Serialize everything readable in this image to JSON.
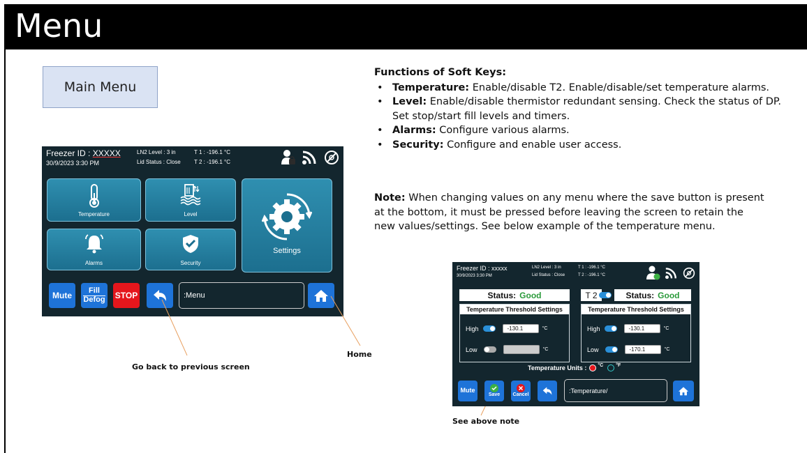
{
  "slide": {
    "title": "Menu",
    "main_menu_label": "Main Menu"
  },
  "device": {
    "freezer_id_label": "Freezer ID :",
    "freezer_id_value": "XXXXX",
    "datetime": "30/9/2023   3:30 PM",
    "ln2_level": "LN2 Level : 3 in",
    "lid_status": "Lid Status : Close",
    "t1": "T 1 : -196.1 °C",
    "t2": "T 2 : -196.1 °C",
    "tiles": {
      "temperature": "Temperature",
      "level": "Level",
      "alarms": "Alarms",
      "security": "Security",
      "settings": "Settings"
    },
    "buttons": {
      "mute": "Mute",
      "fill": "Fill",
      "defog": "Defog",
      "stop": "STOP"
    },
    "breadcrumb": ":Menu"
  },
  "annotations": {
    "back": "Go back to previous screen",
    "home": "Home",
    "save_note": "See above note"
  },
  "functions": {
    "heading": "Functions of Soft Keys:",
    "items": [
      {
        "term": "Temperature:",
        "text": " Enable/disable T2.  Enable/disable/set temperature alarms."
      },
      {
        "term": "Level:",
        "text": "  Enable/disable thermistor redundant sensing.  Check the status of DP.  Set stop/start fill levels and timers."
      },
      {
        "term": "Alarms:",
        "text": " Configure various alarms."
      },
      {
        "term": "Security:",
        "text": " Configure and enable user access."
      }
    ]
  },
  "note": {
    "label": "Note:",
    "text": "  When changing values on any menu where the save button is present at the bottom, it must be pressed before leaving the screen to retain the new values/settings.  See below example of the temperature menu."
  },
  "temp_screen": {
    "freezer_id": "Freezer ID : xxxxx",
    "datetime": "30/9/2023    3:30 PM",
    "ln2_level": "LN2 Level : 3 in",
    "lid_status": "Lid Status : Close",
    "t1": "T 1 : -196.1 °C",
    "t2": "T 2 : -196.1 °C",
    "status_label": "Status:",
    "status_value": "Good",
    "t2_label": "T 2",
    "panel_title": "Temperature Threshold Settings",
    "high_label": "High",
    "low_label": "Low",
    "left_high_value": "-130.1",
    "left_low_value": "",
    "right_high_value": "-130.1",
    "right_low_value": "-170.1",
    "unit_c": "°C",
    "units_label": "Temperature Units :",
    "unit_f": "°F",
    "buttons": {
      "mute": "Mute",
      "save": "Save",
      "cancel": "Cancel"
    },
    "breadcrumb": ":Temperature/"
  },
  "colors": {
    "device_bg": "#13262e",
    "tile_blue": "#2a85a8",
    "button_blue": "#1e73d8",
    "stop_red": "#e5161c",
    "status_green": "#2a9a3a",
    "callout_line": "#e8a060"
  },
  "icons": [
    "user-lock-icon",
    "wifi-icon",
    "no-signal-icon",
    "thermometer-icon",
    "level-icon",
    "bell-icon",
    "shield-check-icon",
    "settings-gear-icon",
    "back-arrow-icon",
    "home-icon",
    "check-icon",
    "x-icon"
  ]
}
